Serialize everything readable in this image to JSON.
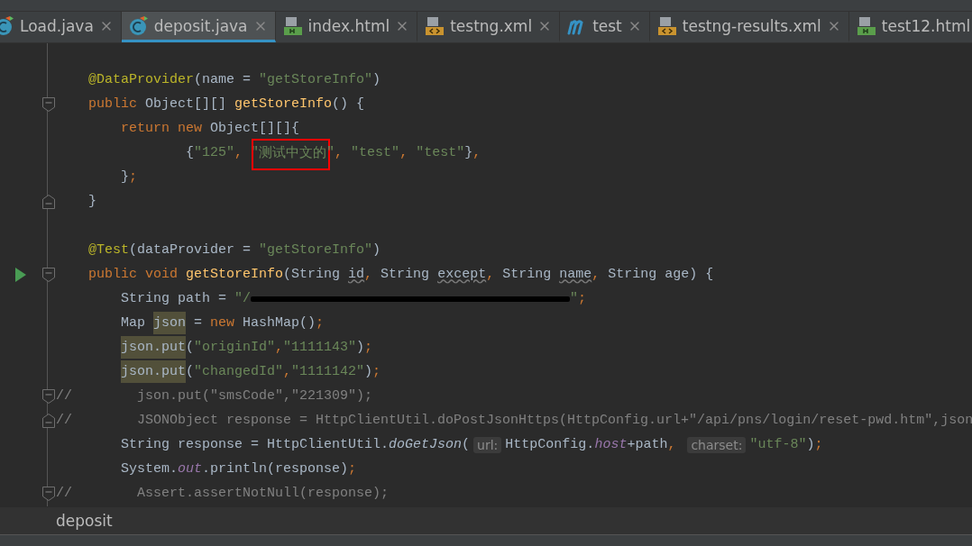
{
  "tabs": [
    {
      "label": "Load.java",
      "kind": "class",
      "selected": false,
      "closable": true
    },
    {
      "label": "deposit.java",
      "kind": "class",
      "selected": true,
      "closable": true
    },
    {
      "label": "index.html",
      "kind": "html",
      "selected": false,
      "closable": true
    },
    {
      "label": "testng.xml",
      "kind": "xml",
      "selected": false,
      "closable": true
    },
    {
      "label": "test",
      "kind": "maven",
      "selected": false,
      "closable": true
    },
    {
      "label": "testng-results.xml",
      "kind": "xml",
      "selected": false,
      "closable": true
    },
    {
      "label": "test12.html",
      "kind": "html",
      "selected": false,
      "closable": false
    }
  ],
  "lines": [
    {
      "kind": "code",
      "tokens": [
        {
          "kind": "ann",
          "text": "    @DataProvider"
        },
        {
          "kind": "plain",
          "text": "(name = "
        },
        {
          "kind": "str",
          "text": "\"getStoreInfo\""
        },
        {
          "kind": "plain",
          "text": ")"
        }
      ]
    },
    {
      "kind": "open",
      "tokens": [
        {
          "kind": "kw",
          "text": "    public "
        },
        {
          "kind": "plain",
          "text": "Object[][] "
        },
        {
          "kind": "decl",
          "text": "getStoreInfo"
        },
        {
          "kind": "plain",
          "text": "() {"
        }
      ]
    },
    {
      "kind": "code",
      "tokens": [
        {
          "kind": "kw",
          "text": "        return new "
        },
        {
          "kind": "plain",
          "text": "Object[][]{"
        }
      ]
    },
    {
      "kind": "code",
      "tokens": [
        {
          "kind": "plain",
          "text": "                {"
        },
        {
          "kind": "str",
          "text": "\"125\""
        },
        {
          "kind": "kw",
          "text": ", "
        },
        {
          "kind": "str",
          "text": "\""
        },
        {
          "kind": "str",
          "text": "测试中文的",
          "boxed": true
        },
        {
          "kind": "str",
          "text": "\""
        },
        {
          "kind": "kw",
          "text": ", "
        },
        {
          "kind": "str",
          "text": "\"test\""
        },
        {
          "kind": "kw",
          "text": ", "
        },
        {
          "kind": "str",
          "text": "\"test\""
        },
        {
          "kind": "plain",
          "text": "}"
        },
        {
          "kind": "kw",
          "text": ","
        }
      ]
    },
    {
      "kind": "code",
      "tokens": [
        {
          "kind": "plain",
          "text": "        }"
        },
        {
          "kind": "kw",
          "text": ";"
        }
      ]
    },
    {
      "kind": "close",
      "tokens": [
        {
          "kind": "plain",
          "text": "    }"
        }
      ]
    },
    {
      "kind": "code"
    },
    {
      "kind": "code",
      "tokens": [
        {
          "kind": "ann",
          "text": "    @Test"
        },
        {
          "kind": "plain",
          "text": "(dataProvider = "
        },
        {
          "kind": "str",
          "text": "\"getStoreInfo\""
        },
        {
          "kind": "plain",
          "text": ")"
        }
      ]
    },
    {
      "kind": "runopen",
      "tokens": [
        {
          "kind": "kw",
          "text": "    public void "
        },
        {
          "kind": "decl",
          "text": "getStoreInfo"
        },
        {
          "kind": "plain",
          "text": "(String "
        },
        {
          "kind": "warn",
          "text": "id"
        },
        {
          "kind": "kw",
          "text": ", "
        },
        {
          "kind": "plain",
          "text": "String "
        },
        {
          "kind": "warn",
          "text": "except"
        },
        {
          "kind": "kw",
          "text": ", "
        },
        {
          "kind": "plain",
          "text": "String "
        },
        {
          "kind": "warn",
          "text": "name"
        },
        {
          "kind": "kw",
          "text": ", "
        },
        {
          "kind": "plain",
          "text": "String age) {"
        }
      ]
    },
    {
      "kind": "code",
      "tokens": [
        {
          "kind": "plain",
          "text": "        String path = "
        },
        {
          "kind": "str",
          "text": "\"/"
        },
        {
          "kind": "redacted"
        },
        {
          "kind": "str",
          "text": "\""
        },
        {
          "kind": "kw",
          "text": ";"
        }
      ]
    },
    {
      "kind": "code",
      "tokens": [
        {
          "kind": "plain",
          "text": "        Map "
        },
        {
          "kind": "hl",
          "text": "json"
        },
        {
          "kind": "plain",
          "text": " = "
        },
        {
          "kind": "kw",
          "text": "new "
        },
        {
          "kind": "plain",
          "text": "HashMap()"
        },
        {
          "kind": "kw",
          "text": ";"
        }
      ]
    },
    {
      "kind": "code",
      "tokens": [
        {
          "kind": "indent"
        },
        {
          "kind": "hl",
          "text": "json.put"
        },
        {
          "kind": "plain",
          "text": "("
        },
        {
          "kind": "str",
          "text": "\"originId\""
        },
        {
          "kind": "kw",
          "text": ","
        },
        {
          "kind": "str",
          "text": "\"1111143\""
        },
        {
          "kind": "plain",
          "text": ")"
        },
        {
          "kind": "kw",
          "text": ";"
        }
      ]
    },
    {
      "kind": "code",
      "tokens": [
        {
          "kind": "indent"
        },
        {
          "kind": "hl",
          "text": "json.put"
        },
        {
          "kind": "plain",
          "text": "("
        },
        {
          "kind": "str",
          "text": "\"changedId\""
        },
        {
          "kind": "kw",
          "text": ","
        },
        {
          "kind": "str",
          "text": "\"1111142\""
        },
        {
          "kind": "plain",
          "text": ")"
        },
        {
          "kind": "kw",
          "text": ";"
        }
      ]
    },
    {
      "kind": "open",
      "tokens": [
        {
          "kind": "cmt",
          "text": "//        json.put(\"smsCode\",\"221309\");"
        }
      ]
    },
    {
      "kind": "close",
      "tokens": [
        {
          "kind": "cmt",
          "text": "//        JSONObject response = HttpClientUtil.doPostJsonHttps(HttpConfig.url+\"/api/pns/login/reset-pwd.htm\",json"
        }
      ]
    },
    {
      "kind": "code",
      "tokens": [
        {
          "kind": "plain",
          "text": "        String response = HttpClientUtil."
        },
        {
          "kind": "static",
          "text": "doGetJson"
        },
        {
          "kind": "plain",
          "text": "("
        },
        {
          "kind": "hint",
          "text": "url:"
        },
        {
          "kind": "plain",
          "text": "HttpConfig."
        },
        {
          "kind": "field",
          "text": "host"
        },
        {
          "kind": "plain",
          "text": "+path"
        },
        {
          "kind": "kw",
          "text": ", "
        },
        {
          "kind": "hint",
          "text": "charset:"
        },
        {
          "kind": "str",
          "text": "\"utf-8\""
        },
        {
          "kind": "plain",
          "text": ")"
        },
        {
          "kind": "kw",
          "text": ";"
        }
      ]
    },
    {
      "kind": "code",
      "tokens": [
        {
          "kind": "plain",
          "text": "        System."
        },
        {
          "kind": "field",
          "text": "out"
        },
        {
          "kind": "plain",
          "text": ".println(response)"
        },
        {
          "kind": "kw",
          "text": ";"
        }
      ]
    },
    {
      "kind": "open",
      "tokens": [
        {
          "kind": "cmt",
          "text": "//        Assert.assertNotNull(response);"
        }
      ]
    }
  ],
  "breadcrumb": "deposit"
}
